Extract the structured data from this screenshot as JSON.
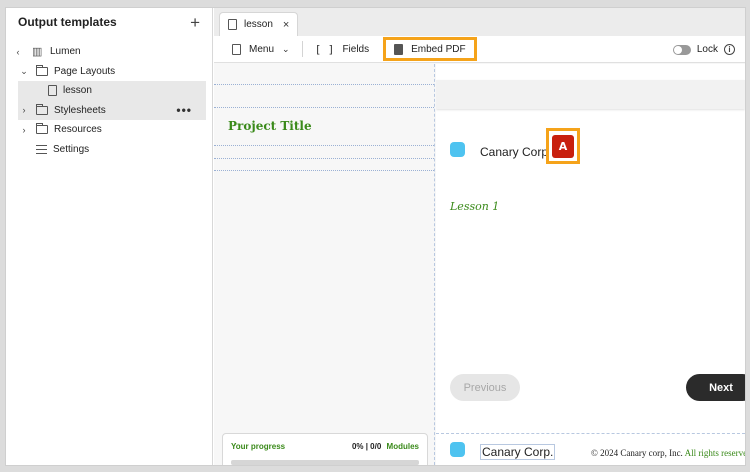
{
  "sidebar": {
    "title": "Output templates",
    "add_label": "+",
    "tree": [
      {
        "label": "Lumen",
        "icon": "library-icon",
        "twisty": "‹"
      },
      {
        "label": "Page Layouts",
        "icon": "folder-icon",
        "twisty": "⌄"
      },
      {
        "label": "lesson",
        "icon": "file-icon",
        "twisty": ""
      },
      {
        "label": "Stylesheets",
        "icon": "folder-icon",
        "twisty": "›",
        "more": "•••"
      },
      {
        "label": "Resources",
        "icon": "folder-icon",
        "twisty": "›"
      },
      {
        "label": "Settings",
        "icon": "settings-icon",
        "twisty": ""
      }
    ]
  },
  "tabs": [
    {
      "label": "lesson",
      "close": "×"
    }
  ],
  "toolbar": {
    "menu_label": "Menu",
    "menu_chevron": "⌄",
    "fields_brackets": "[ ]",
    "fields_label": "Fields",
    "embed_label": "Embed PDF",
    "lock_label": "Lock",
    "info_glyph": "i"
  },
  "canvas": {
    "project_title": "Project Title",
    "progress": {
      "label": "Your progress",
      "value": "0% | 0/0",
      "unit": "Modules",
      "fraction": 0
    },
    "brand": "Canary Corp.",
    "brand_header": "Canary Corp",
    "pdf_glyph": "A",
    "lesson_label": "Lesson 1",
    "prev_label": "Previous",
    "next_label": "Next",
    "copyright": "© 2024 Canary corp, Inc.",
    "rights": "All rights reserve"
  },
  "colors": {
    "accent_highlight": "#f5a31a",
    "title_green": "#3a8a1a",
    "pdf_red": "#c8200e"
  }
}
